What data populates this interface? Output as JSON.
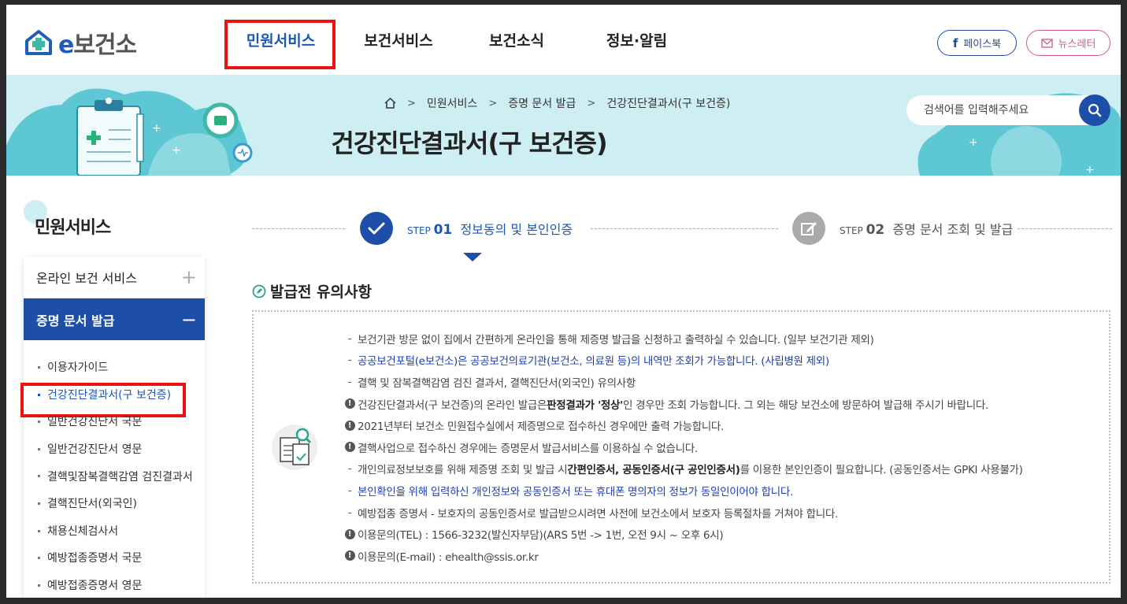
{
  "header": {
    "logo_text": "보건소",
    "logo_prefix": "e",
    "nav": [
      "민원서비스",
      "보건서비스",
      "보건소식",
      "정보·알림"
    ],
    "facebook_label": "페이스북",
    "newsletter_label": "뉴스레터"
  },
  "banner": {
    "breadcrumb": [
      "민원서비스",
      "증명 문서 발급",
      "건강진단결과서(구 보건증)"
    ],
    "title": "건강진단결과서(구 보건증)",
    "search_placeholder": "검색어를 입력해주세요"
  },
  "sidebar": {
    "title": "민원서비스",
    "menus": [
      {
        "label": "온라인 보건 서비스",
        "toggle": "+"
      },
      {
        "label": "증명 문서 발급",
        "toggle": "−"
      }
    ],
    "sub_items": [
      "이용자가이드",
      "건강진단결과서(구 보건증)",
      "일반건강진단서 국문",
      "일반건강진단서 영문",
      "결핵및잠복결핵감염 검진결과서",
      "결핵진단서(외국인)",
      "채용신체검사서",
      "예방접종증명서 국문",
      "예방접종증명서 영문"
    ]
  },
  "steps": [
    {
      "prefix": "STEP",
      "num": "01",
      "label": "정보동의 및 본인인증"
    },
    {
      "prefix": "STEP",
      "num": "02",
      "label": "증명 문서 조회 및 발급"
    }
  ],
  "notice": {
    "title": "발급전 유의사항",
    "items": [
      {
        "type": "dash",
        "text": "보건기관 방문 없이 집에서 간편하게 온라인을 통해 제증명 발급을 신청하고 출력하실 수 있습니다. (일부 보건기관 제외)"
      },
      {
        "type": "dash-blue",
        "text": "공공보건포털(e보건소)은 공공보건의료기관(보건소, 의료원 등)의 내역만 조회가 가능합니다. (사립병원 제외)"
      },
      {
        "type": "dash",
        "text": "결핵 및 잠복결핵감염 검진 결과서, 결핵진단서(외국인) 유의사항"
      },
      {
        "type": "exc",
        "parts": [
          "건강진단결과서(구 보건증)의 온라인 발급은 ",
          "판정결과가 '정상'",
          "인 경우만 조회 가능합니다. 그 외는 해당 보건소에 방문하여 발급해 주시기 바랍니다."
        ]
      },
      {
        "type": "exc",
        "text": "2021년부터 보건소 민원접수실에서 제증명으로 접수하신 경우에만 출력 가능합니다."
      },
      {
        "type": "exc",
        "text": "결핵사업으로 접수하신 경우에는 증명문서 발급서비스를 이용하실 수 없습니다."
      },
      {
        "type": "dash",
        "parts": [
          "개인의료정보보호를 위해 제증명 조회 및 발급 시 ",
          "간편인증서, 공동인증서(구 공인인증서)",
          "를 이용한 본인인증이 필요합니다. (공동인증서는 GPKI 사용불가)"
        ]
      },
      {
        "type": "dash-blue",
        "text": "본인확인을 위해 입력하신 개인정보와 공동인증서 또는 휴대폰 명의자의 정보가 동일인이어야 합니다."
      },
      {
        "type": "dash",
        "text": "예방접종 증명서 - 보호자의 공동인증서로 발급받으시려면 사전에 보건소에서 보호자 등록절차를 거쳐야 합니다."
      },
      {
        "type": "exc",
        "text": "이용문의(TEL) : 1566-3232(발신자부담)(ARS 5번 -> 1번, 오전 9시 ~ 오후 6시)"
      },
      {
        "type": "exc",
        "text": "이용문의(E-mail) : ehealth@ssis.or.kr"
      }
    ]
  },
  "colors": {
    "primary": "#1d4fa9",
    "highlight": "#ee1111",
    "banner_bg": "#cdeef2",
    "teal": "#5dc7d3"
  }
}
